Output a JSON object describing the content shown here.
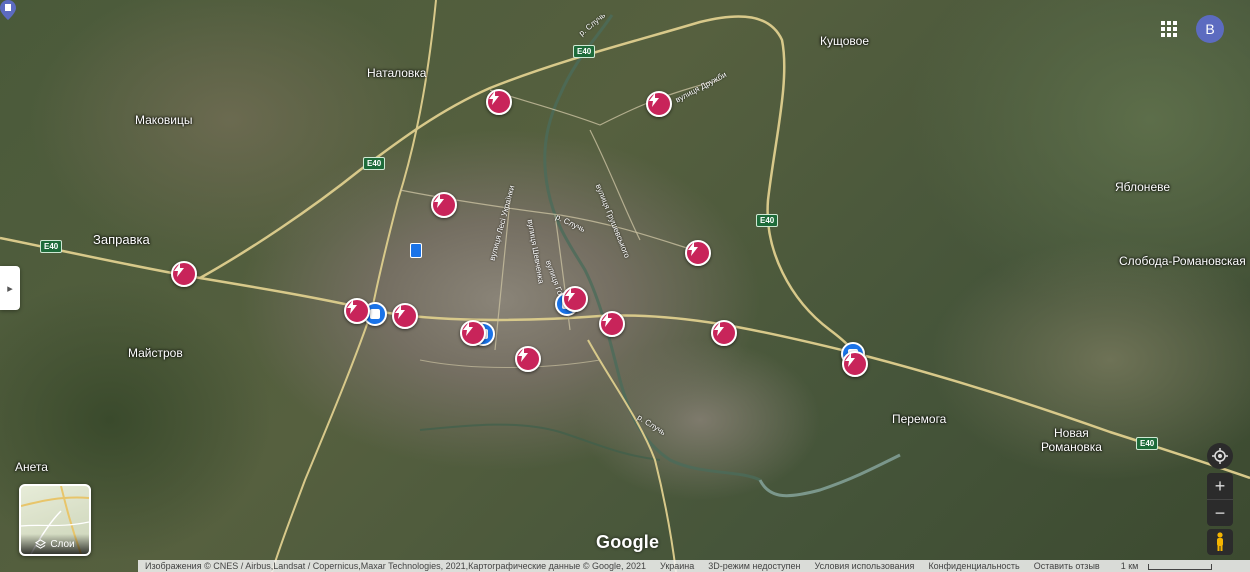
{
  "places": {
    "kushchovoe": "Кущовое",
    "natalovka": "Наталовка",
    "makovitsy": "Маковицы",
    "yabloneve": "Яблоневе",
    "sloboda": "Слобода-Романовская",
    "maystrov": "Майстров",
    "peremoga": "Перемога",
    "novaya_romanovka_1": "Новая",
    "novaya_romanovka_2": "Романовка",
    "aneta": "Анета",
    "gas_station": "Заправка"
  },
  "streets": {
    "druzhby": "вулиця Дружби",
    "grushevskogo": "вулиця Грушевського",
    "lesi_ukrainki": "вулиця Лесі Українки",
    "shevchenka": "вулиця Шевченка",
    "gogolya": "вулиця Гоголя",
    "river_1": "р. Случь",
    "river_2": "р. Случь",
    "river_3": "р. Случь"
  },
  "road_label": "E40",
  "account_initial": "B",
  "layers_label": "Слои",
  "google_logo": "Google",
  "footer": {
    "attribution": "Изображения © CNES / Airbus,Landsat / Copernicus,Maxar Technologies, 2021,Картографические данные © Google, 2021",
    "country": "Украина",
    "mode_3d": "3D-режим недоступен",
    "terms": "Условия использования",
    "privacy": "Конфиденциальность",
    "feedback": "Оставить отзыв",
    "scale": "1 км"
  },
  "colors": {
    "ev_marker": "#c8245a",
    "transit_marker": "#1a73e8",
    "road_shield": "#1e6b3a"
  }
}
